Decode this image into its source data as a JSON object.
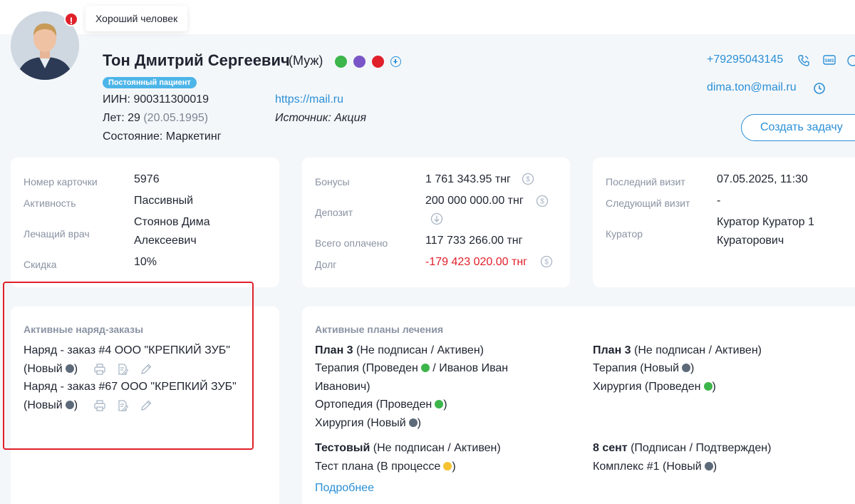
{
  "patient": {
    "tooltip": "Хороший человек",
    "name": "Тон Дмитрий Сергеевич",
    "gender": "(Муж)",
    "tag_colors": [
      "#3cb54a",
      "#7a55c8",
      "#e0202a"
    ],
    "badge": "Постоянный пациент",
    "iin_label": "ИИН:",
    "iin": "900311300019",
    "age_label": "Лет:",
    "age": "29",
    "birth": "(20.05.1995)",
    "state_label": "Состояние:",
    "state": "Маркетинг",
    "website": "https://mail.ru",
    "source": "Источник: Акция",
    "phone": "+79295043145",
    "email": "dima.ton@mail.ru",
    "create_task": "Создать задачу"
  },
  "card1": {
    "card_number_label": "Номер карточки",
    "card_number": "5976",
    "activity_label": "Активность",
    "activity": "Пассивный",
    "doctor_label": "Лечащий врач",
    "doctor_line1": "Стоянов Дима",
    "doctor_line2": "Алексеевич",
    "discount_label": "Скидка",
    "discount": "10%"
  },
  "card2": {
    "bonuses_label": "Бонусы",
    "bonuses": "1 761 343.95 тнг",
    "deposit_label": "Депозит",
    "deposit": "200 000 000.00 тнг",
    "paid_label": "Всего оплачено",
    "paid": "117 733 266.00 тнг",
    "debt_label": "Долг",
    "debt": "-179 423 020.00 тнг"
  },
  "card3": {
    "last_visit_label": "Последний визит",
    "last_visit": "07.05.2025, 11:30",
    "next_visit_label": "Следующий визит",
    "next_visit": "-",
    "curator_label": "Куратор",
    "curator_line1": "Куратор Куратор 1",
    "curator_line2": "Кураторович"
  },
  "orders": {
    "title": "Активные наряд-заказы",
    "items": [
      {
        "line1": "Наряд - заказ #4 ООО \"КРЕПКИЙ ЗУБ\"",
        "status": "(Новый",
        "close": ")"
      },
      {
        "line1": "Наряд - заказ #67 ООО \"КРЕПКИЙ ЗУБ\"",
        "status": "(Новый",
        "close": ")"
      }
    ],
    "status_color": "#5d6a7a"
  },
  "plans": {
    "title": "Активные планы лечения",
    "more": "Подробнее",
    "colors": {
      "new": "#5d6a7a",
      "done": "#3cb54a",
      "progress": "#f5c231"
    },
    "p1": {
      "name": "План 3",
      "state": "(Не подписан / Активен)",
      "i1": "Терапия (Проведен",
      "i1b": "/ Иванов Иван",
      "i1c": "Иванович)",
      "i2": "Ортопедия (Проведен",
      "i3": "Хирургия (Новый"
    },
    "p2": {
      "name": "План 3",
      "state": "(Не подписан / Активен)",
      "i1": "Терапия (Новый",
      "i2": "Хирургия (Проведен"
    },
    "p3": {
      "name": "Тестовый",
      "state": "(Не подписан / Активен)",
      "i1": "Тест плана (В процессе"
    },
    "p4": {
      "name": "8 сент",
      "state": "(Подписан / Подтвержден)",
      "i1": "Комплекс #1 (Новый"
    },
    "close": ")"
  }
}
